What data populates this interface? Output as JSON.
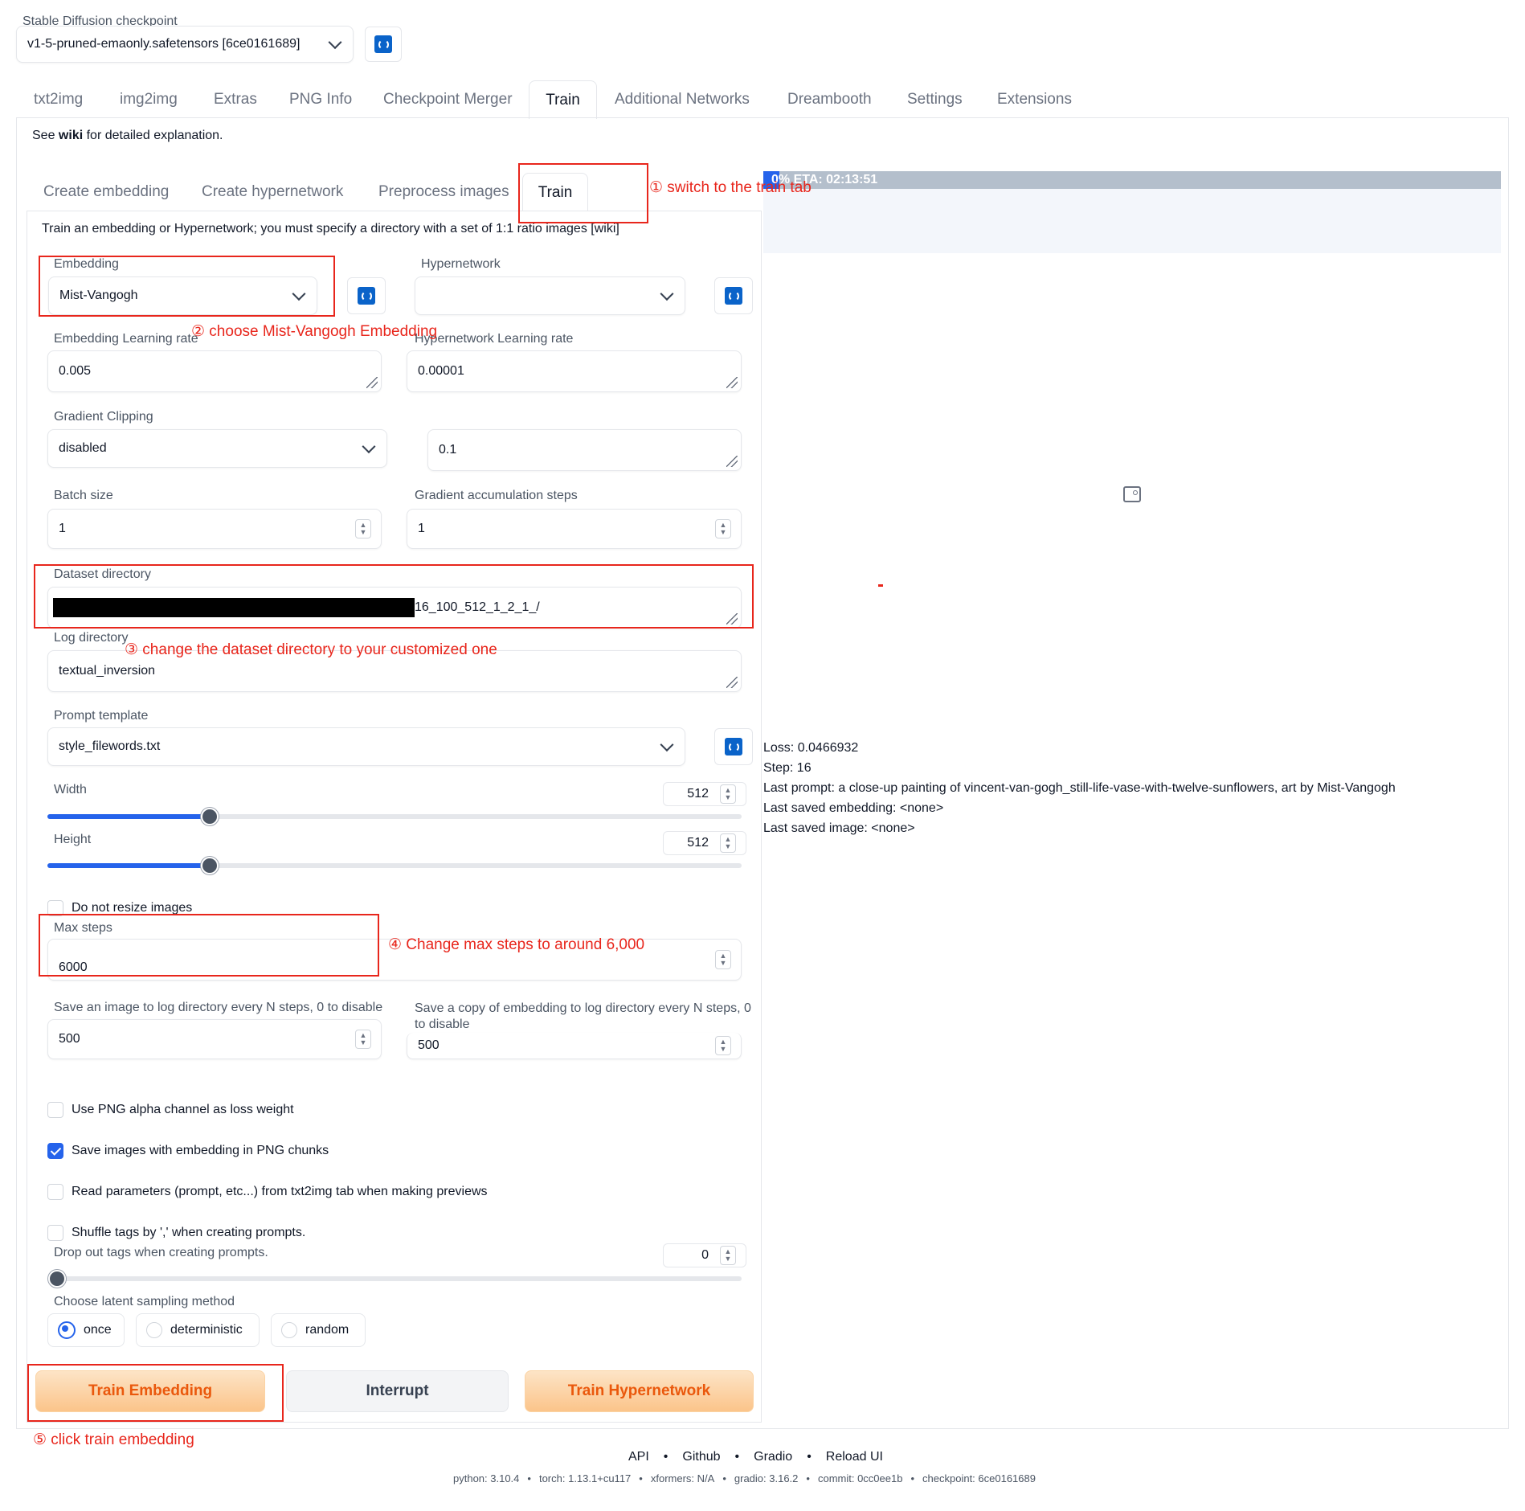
{
  "checkpoint": {
    "label": "Stable Diffusion checkpoint",
    "value": "v1-5-pruned-emaonly.safetensors [6ce0161689]"
  },
  "main_tabs": [
    "txt2img",
    "img2img",
    "Extras",
    "PNG Info",
    "Checkpoint Merger",
    "Train",
    "Additional Networks",
    "Dreambooth",
    "Settings",
    "Extensions"
  ],
  "active_main_tab": "Train",
  "wiki_line": {
    "prefix": "See ",
    "link": "wiki",
    "suffix": " for detailed explanation."
  },
  "sub_tabs": [
    "Create embedding",
    "Create hypernetwork",
    "Preprocess images",
    "Train"
  ],
  "active_sub_tab": "Train",
  "train_description": "Train an embedding or Hypernetwork; you must specify a directory with a set of 1:1 ratio images [wiki]",
  "form": {
    "embedding_label": "Embedding",
    "embedding_value": "Mist-Vangogh",
    "hypernetwork_label": "Hypernetwork",
    "hypernetwork_value": "",
    "embedding_lr_label": "Embedding Learning rate",
    "embedding_lr_value": "0.005",
    "hypernetwork_lr_label": "Hypernetwork Learning rate",
    "hypernetwork_lr_value": "0.00001",
    "grad_clip_label": "Gradient Clipping",
    "grad_clip_value": "disabled",
    "grad_clip_amount": "0.1",
    "batch_size_label": "Batch size",
    "batch_size_value": "1",
    "grad_accum_label": "Gradient accumulation steps",
    "grad_accum_value": "1",
    "dataset_dir_label": "Dataset directory",
    "dataset_dir_value": "16_100_512_1_2_1_/",
    "log_dir_label": "Log directory",
    "log_dir_value": "textual_inversion",
    "prompt_template_label": "Prompt template",
    "prompt_template_value": "style_filewords.txt",
    "width_label": "Width",
    "width_value": "512",
    "width_fraction": 0.23,
    "height_label": "Height",
    "height_value": "512",
    "height_fraction": 0.23,
    "no_resize_label": "Do not resize images",
    "max_steps_label": "Max steps",
    "max_steps_value": "6000",
    "save_image_label": "Save an image to log directory every N steps, 0 to disable",
    "save_image_value": "500",
    "save_embedding_label": "Save a copy of embedding to log directory every N steps, 0 to disable",
    "save_embedding_value": "500",
    "png_alpha_label": "Use PNG alpha channel as loss weight",
    "save_png_chunks_label": "Save images with embedding in PNG chunks",
    "read_params_label": "Read parameters (prompt, etc...) from txt2img tab when making previews",
    "shuffle_tags_label": "Shuffle tags by ',' when creating prompts.",
    "dropout_label": "Drop out tags when creating prompts.",
    "dropout_value": "0",
    "latent_label": "Choose latent sampling method",
    "latent_options": [
      "once",
      "deterministic",
      "random"
    ],
    "latent_selected": "once"
  },
  "buttons": {
    "train_embedding": "Train Embedding",
    "interrupt": "Interrupt",
    "train_hypernetwork": "Train Hypernetwork"
  },
  "progress": {
    "text": "0% ETA: 02:13:51",
    "percent": 0
  },
  "output": {
    "loss": "Loss: 0.0466932",
    "step": "Step: 16",
    "last_prompt": "Last prompt: a close-up painting of vincent-van-gogh_still-life-vase-with-twelve-sunflowers, art by Mist-Vangogh",
    "last_embedding": "Last saved embedding: <none>",
    "last_image": "Last saved image: <none>"
  },
  "annotations": {
    "a1": "① switch to the train tab",
    "a2": "② choose Mist-Vangogh Embedding",
    "a3": "③ change the dataset directory to your customized one",
    "a4": "④ Change max steps to around 6,000",
    "a5": "⑤ click train embedding"
  },
  "footer": {
    "links": [
      "API",
      "Github",
      "Gradio",
      "Reload UI"
    ],
    "separator": "•",
    "info": [
      "python: 3.10.4",
      "torch: 1.13.1+cu117",
      "xformers: N/A",
      "gradio: 3.16.2",
      "commit: 0cc0ee1b",
      "checkpoint: 6ce0161689"
    ]
  },
  "colors": {
    "accent": "#2563eb",
    "annotation_red": "#e8261c",
    "button_orange_text": "#ea580c"
  }
}
